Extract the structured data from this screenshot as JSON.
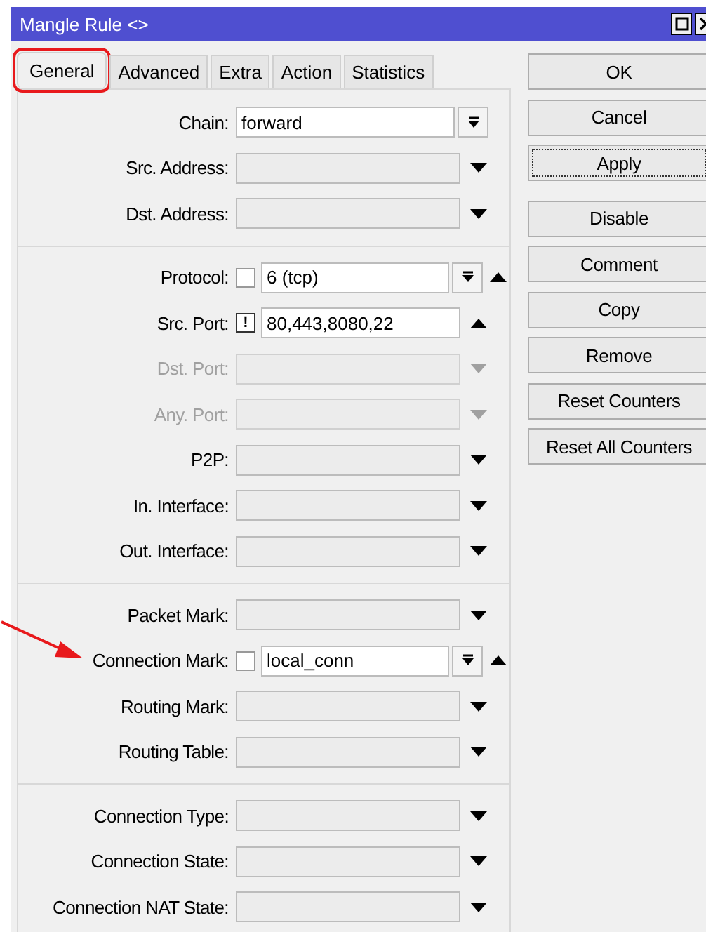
{
  "window": {
    "title": "Mangle Rule <>"
  },
  "tabs": [
    {
      "label": "General",
      "selected": true,
      "annotated": true
    },
    {
      "label": "Advanced",
      "selected": false,
      "annotated": false
    },
    {
      "label": "Extra",
      "selected": false,
      "annotated": false
    },
    {
      "label": "Action",
      "selected": false,
      "annotated": false
    },
    {
      "label": "Statistics",
      "selected": false,
      "annotated": false
    }
  ],
  "sections": [
    [
      {
        "label": "Chain:",
        "value": "forward",
        "kind": "select",
        "disabled": false
      },
      {
        "label": "Src. Address:",
        "kind": "list",
        "disabled": false
      },
      {
        "label": "Dst. Address:",
        "kind": "list",
        "disabled": false
      }
    ],
    [
      {
        "label": "Protocol:",
        "negate": {
          "on": false
        },
        "value": "6 (tcp)",
        "kind": "combo",
        "disabled": false
      },
      {
        "label": "Src. Port:",
        "negate": {
          "on": true,
          "mark": "!"
        },
        "value": "80,443,8080,22",
        "kind": "port",
        "disabled": false
      },
      {
        "label": "Dst. Port:",
        "kind": "list",
        "disabled": true
      },
      {
        "label": "Any. Port:",
        "kind": "list",
        "disabled": true
      },
      {
        "label": "P2P:",
        "kind": "list",
        "disabled": false
      },
      {
        "label": "In. Interface:",
        "kind": "list",
        "disabled": false
      },
      {
        "label": "Out. Interface:",
        "kind": "list",
        "disabled": false
      }
    ],
    [
      {
        "label": "Packet Mark:",
        "kind": "list",
        "disabled": false
      },
      {
        "label": "Connection Mark:",
        "negate": {
          "on": false
        },
        "value": "local_conn",
        "kind": "combo",
        "disabled": false,
        "pointer": true
      },
      {
        "label": "Routing Mark:",
        "kind": "list",
        "disabled": false
      },
      {
        "label": "Routing Table:",
        "kind": "list",
        "disabled": false
      }
    ],
    [
      {
        "label": "Connection Type:",
        "kind": "list",
        "disabled": false
      },
      {
        "label": "Connection State:",
        "kind": "list",
        "disabled": false
      },
      {
        "label": "Connection NAT State:",
        "kind": "list",
        "disabled": false
      }
    ]
  ],
  "buttons": [
    {
      "label": "OK",
      "focused": false
    },
    {
      "label": "Cancel",
      "focused": false
    },
    {
      "label": "Apply",
      "focused": true
    },
    {
      "label": "Disable",
      "focused": false
    },
    {
      "label": "Comment",
      "focused": false
    },
    {
      "label": "Copy",
      "focused": false
    },
    {
      "label": "Remove",
      "focused": false
    },
    {
      "label": "Reset Counters",
      "focused": false
    },
    {
      "label": "Reset All Counters",
      "focused": false
    }
  ]
}
